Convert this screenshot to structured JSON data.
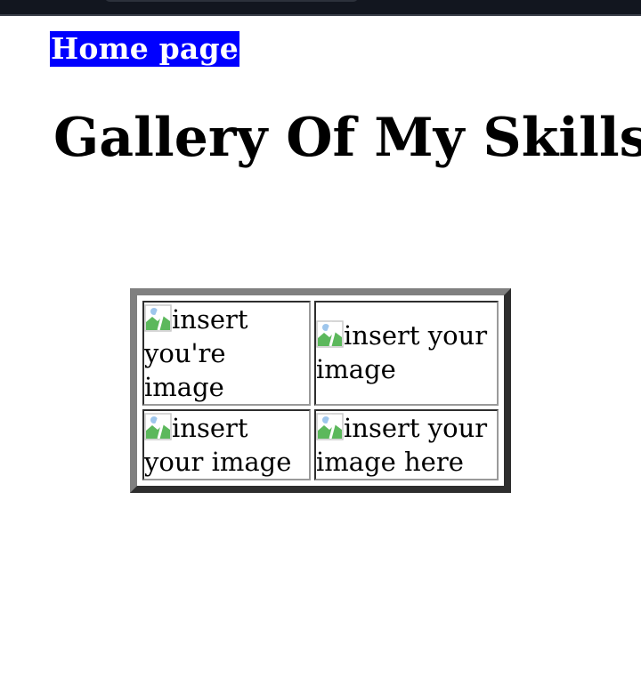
{
  "nav": {
    "home_link": "Home page"
  },
  "page": {
    "title": "Gallery Of My Skills"
  },
  "gallery": {
    "cells": [
      {
        "alt": "insert you're image",
        "lines": [
          "insert",
          "you're",
          "image"
        ]
      },
      {
        "alt": "insert your image",
        "lines": [
          "insert your",
          "image"
        ]
      },
      {
        "alt": "insert your image",
        "lines": [
          "insert",
          "your image"
        ]
      },
      {
        "alt": "insert your image here",
        "lines": [
          "insert your",
          "image here"
        ]
      }
    ],
    "broken_image_icon": "broken-image-icon"
  },
  "colors": {
    "link_background": "#0000ff",
    "link_text": "#ffffff",
    "top_bar": "#12161f"
  }
}
